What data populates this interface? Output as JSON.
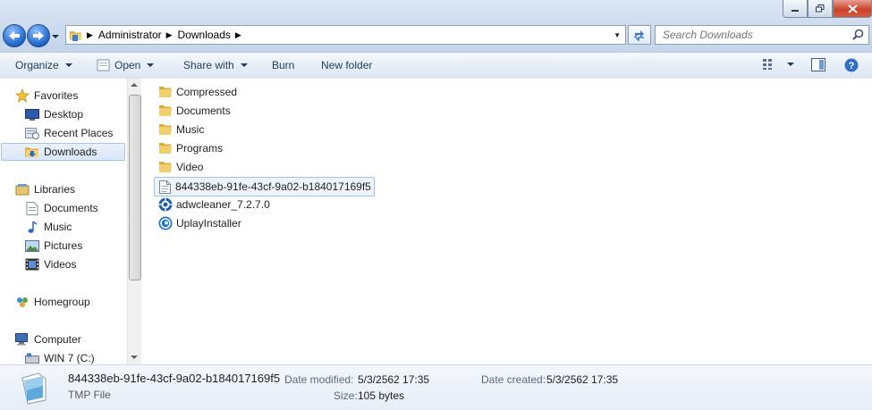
{
  "address": {
    "segments": [
      "Administrator",
      "Downloads"
    ]
  },
  "search": {
    "placeholder": "Search Downloads"
  },
  "toolbar": {
    "organize": "Organize",
    "open": "Open",
    "share_with": "Share with",
    "burn": "Burn",
    "new_folder": "New folder"
  },
  "nav": {
    "favorites": "Favorites",
    "desktop": "Desktop",
    "recent_places": "Recent Places",
    "downloads": "Downloads",
    "libraries": "Libraries",
    "documents": "Documents",
    "music": "Music",
    "pictures": "Pictures",
    "videos": "Videos",
    "homegroup": "Homegroup",
    "computer": "Computer",
    "win7": "WIN 7 (C:)"
  },
  "files": [
    {
      "name": "Compressed",
      "type": "folder"
    },
    {
      "name": "Documents",
      "type": "folder"
    },
    {
      "name": "Music",
      "type": "folder"
    },
    {
      "name": "Programs",
      "type": "folder"
    },
    {
      "name": "Video",
      "type": "folder"
    },
    {
      "name": "844338eb-91fe-43cf-9a02-b184017169f5",
      "type": "tmp",
      "selected": true
    },
    {
      "name": "adwcleaner_7.2.7.0",
      "type": "adwcleaner"
    },
    {
      "name": "UplayInstaller",
      "type": "uplay"
    }
  ],
  "details": {
    "name": "844338eb-91fe-43cf-9a02-b184017169f5",
    "type": "TMP File",
    "modified_label": "Date modified:",
    "modified_value": "5/3/2562 17:35",
    "size_label": "Size:",
    "size_value": "105 bytes",
    "created_label": "Date created:",
    "created_value": "5/3/2562 17:35"
  },
  "colors": {
    "folder": "#e8c05a",
    "accent": "#1e395b",
    "selection": "#99c2ee"
  }
}
